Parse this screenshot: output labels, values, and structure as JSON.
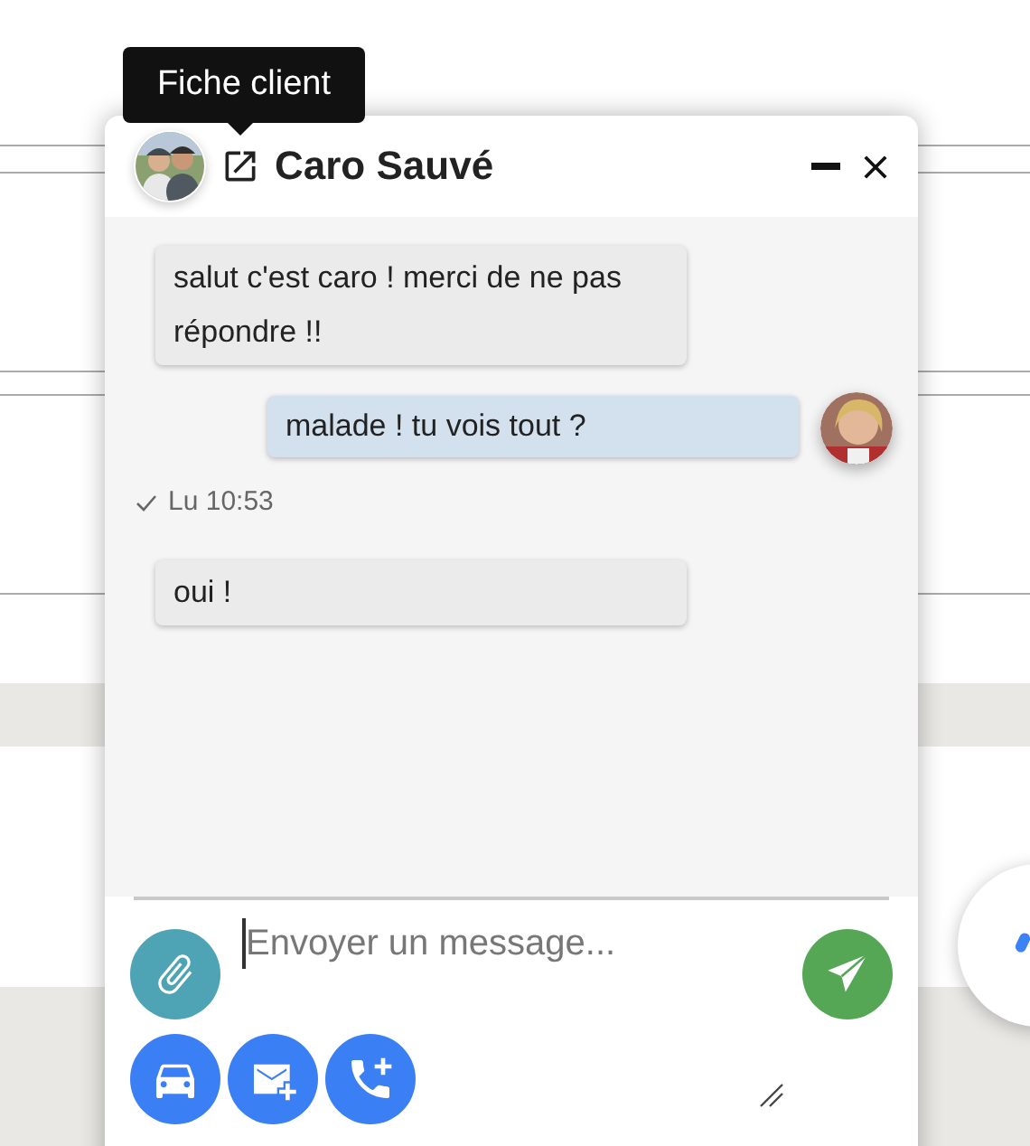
{
  "tooltip": {
    "text": "Fiche client"
  },
  "chat": {
    "title": "Caro Sauvé",
    "messages": [
      {
        "kind": "received",
        "text": "salut c'est caro ! merci de ne pas répondre !!"
      },
      {
        "kind": "sent",
        "text": "malade ! tu vois tout ?"
      },
      {
        "kind": "status",
        "read": true,
        "text": "Lu 10:53"
      },
      {
        "kind": "received",
        "text": "oui !"
      }
    ],
    "input": {
      "placeholder": "Envoyer un message..."
    }
  }
}
